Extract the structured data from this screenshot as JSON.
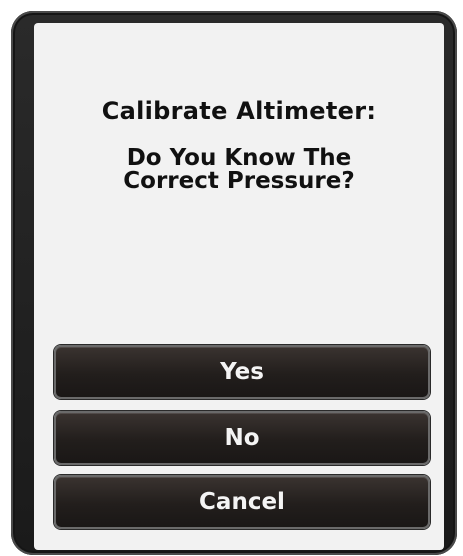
{
  "dialog": {
    "title": "Calibrate Altimeter:",
    "question": "Do You Know The\nCorrect Pressure?"
  },
  "buttons": {
    "yes": "Yes",
    "no": "No",
    "cancel": "Cancel"
  },
  "colors": {
    "screen_background": "#f2f2f2",
    "bezel": "#1f1f1f",
    "button_background": "#221e1c",
    "button_text": "#f4f4f4",
    "text": "#111111"
  }
}
